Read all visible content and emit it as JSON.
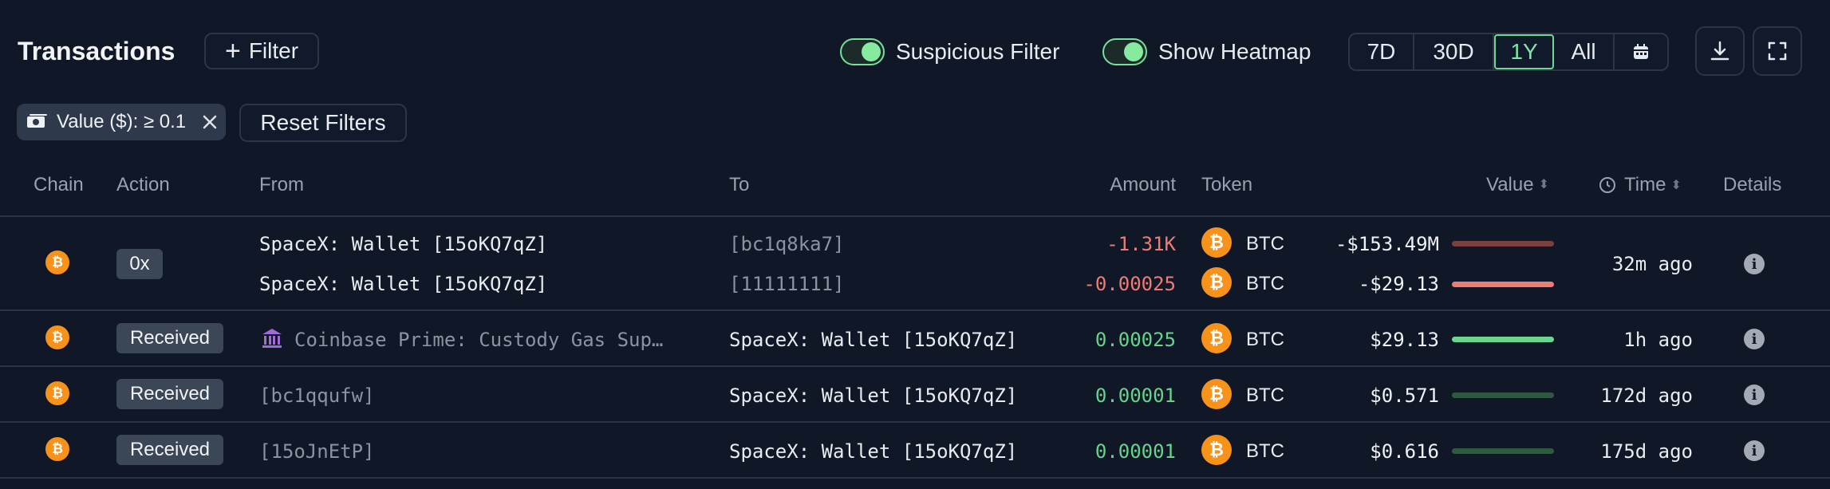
{
  "header": {
    "title": "Transactions",
    "filter_label": "Filter",
    "toggles": [
      {
        "label": "Suspicious Filter",
        "on": true
      },
      {
        "label": "Show Heatmap",
        "on": true
      }
    ],
    "periods": [
      "7D",
      "30D",
      "1Y",
      "All"
    ],
    "active_period": "1Y"
  },
  "chips": {
    "value_filter": "Value ($): ≥ 0.1",
    "reset_label": "Reset Filters"
  },
  "table": {
    "columns": {
      "chain": "Chain",
      "action": "Action",
      "from": "From",
      "to": "To",
      "amount": "Amount",
      "token": "Token",
      "value": "Value",
      "time": "Time",
      "details": "Details"
    },
    "rows": [
      {
        "action": "0x",
        "lines": [
          {
            "from": "SpaceX: Wallet [15oKQ7qZ]",
            "to": "[bc1q8ka7]",
            "amount": "-1.31K",
            "token": "BTC",
            "value": "-$153.49M",
            "bar_fraction": 1.0
          },
          {
            "from": "SpaceX: Wallet [15oKQ7qZ]",
            "to": "[11111111]",
            "amount": "-0.00025",
            "token": "BTC",
            "value": "-$29.13",
            "bar_fraction": 1.0
          }
        ],
        "time": "32m ago"
      },
      {
        "action": "Received",
        "from": "Coinbase Prime: Custody Gas Sup…",
        "to": "SpaceX: Wallet [15oKQ7qZ]",
        "amount": "0.00025",
        "token": "BTC",
        "value": "$29.13",
        "bar_fraction": 1.0,
        "time": "1h ago"
      },
      {
        "action": "Received",
        "from": "[bc1qqufw]",
        "to": "SpaceX: Wallet [15oKQ7qZ]",
        "amount": "0.00001",
        "token": "BTC",
        "value": "$0.571",
        "bar_fraction": 1.0,
        "time": "172d ago"
      },
      {
        "action": "Received",
        "from": "[15oJnEtP]",
        "to": "SpaceX: Wallet [15oKQ7qZ]",
        "amount": "0.00001",
        "token": "BTC",
        "value": "$0.616",
        "bar_fraction": 1.0,
        "time": "175d ago"
      }
    ]
  },
  "colors": {
    "accent_green": "#6fd992",
    "negative": "#ef7b74",
    "positive": "#66d48b",
    "btc": "#f7931a"
  }
}
